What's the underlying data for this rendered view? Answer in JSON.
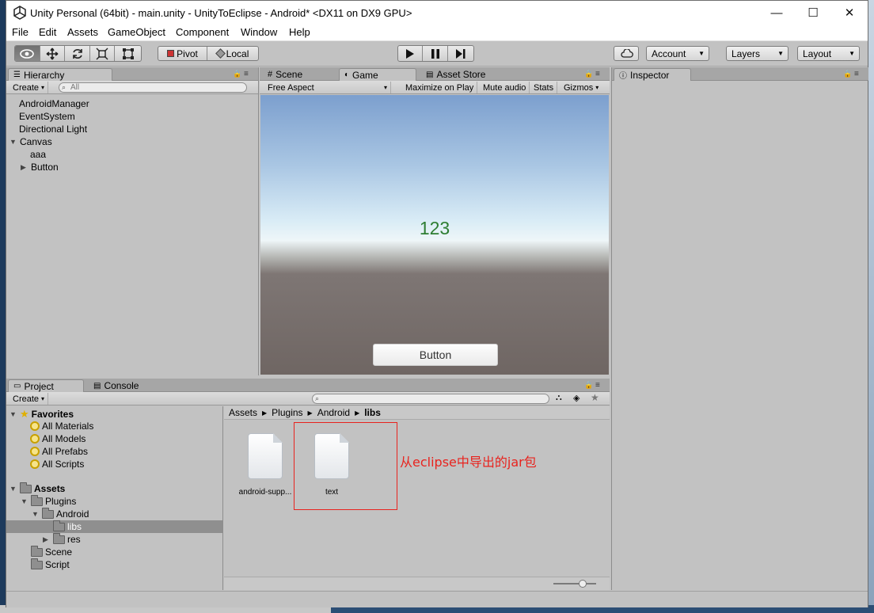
{
  "window": {
    "title": "Unity Personal (64bit) - main.unity - UnityToEclipse - Android* <DX11 on DX9 GPU>",
    "controls": {
      "minimize": "—",
      "maximize": "☐",
      "close": "✕"
    }
  },
  "menu": [
    "File",
    "Edit",
    "Assets",
    "GameObject",
    "Component",
    "Window",
    "Help"
  ],
  "toolbar": {
    "pivot": "Pivot",
    "local": "Local",
    "account": "Account",
    "layers": "Layers",
    "layout": "Layout"
  },
  "hierarchy": {
    "tab": "Hierarchy",
    "create": "Create",
    "search_placeholder": "All",
    "items": [
      "AndroidManager",
      "EventSystem",
      "Directional Light",
      "Canvas",
      "aaa",
      "Button"
    ]
  },
  "scene_tabs": {
    "scene": "Scene",
    "game": "Game",
    "asset_store": "Asset Store"
  },
  "game": {
    "aspect": "Free Aspect",
    "maximize": "Maximize on Play",
    "mute": "Mute audio",
    "stats": "Stats",
    "gizmos": "Gizmos",
    "display_text": "123",
    "button_label": "Button"
  },
  "inspector": {
    "tab": "Inspector"
  },
  "project": {
    "tab": "Project",
    "console_tab": "Console",
    "create": "Create",
    "favorites": {
      "label": "Favorites",
      "items": [
        "All Materials",
        "All Models",
        "All Prefabs",
        "All Scripts"
      ]
    },
    "assets": {
      "label": "Assets",
      "plugins": "Plugins",
      "android": "Android",
      "libs": "libs",
      "res": "res",
      "scene": "Scene",
      "script": "Script"
    },
    "breadcrumb": [
      "Assets",
      "Plugins",
      "Android",
      "libs"
    ],
    "files": [
      "android-supp...",
      "text"
    ],
    "annotation": "从eclipse中导出的jar包"
  },
  "colors": {
    "annotation": "#e8231e",
    "game_text": "#2e7d32",
    "selection": "#8f8f8f"
  }
}
